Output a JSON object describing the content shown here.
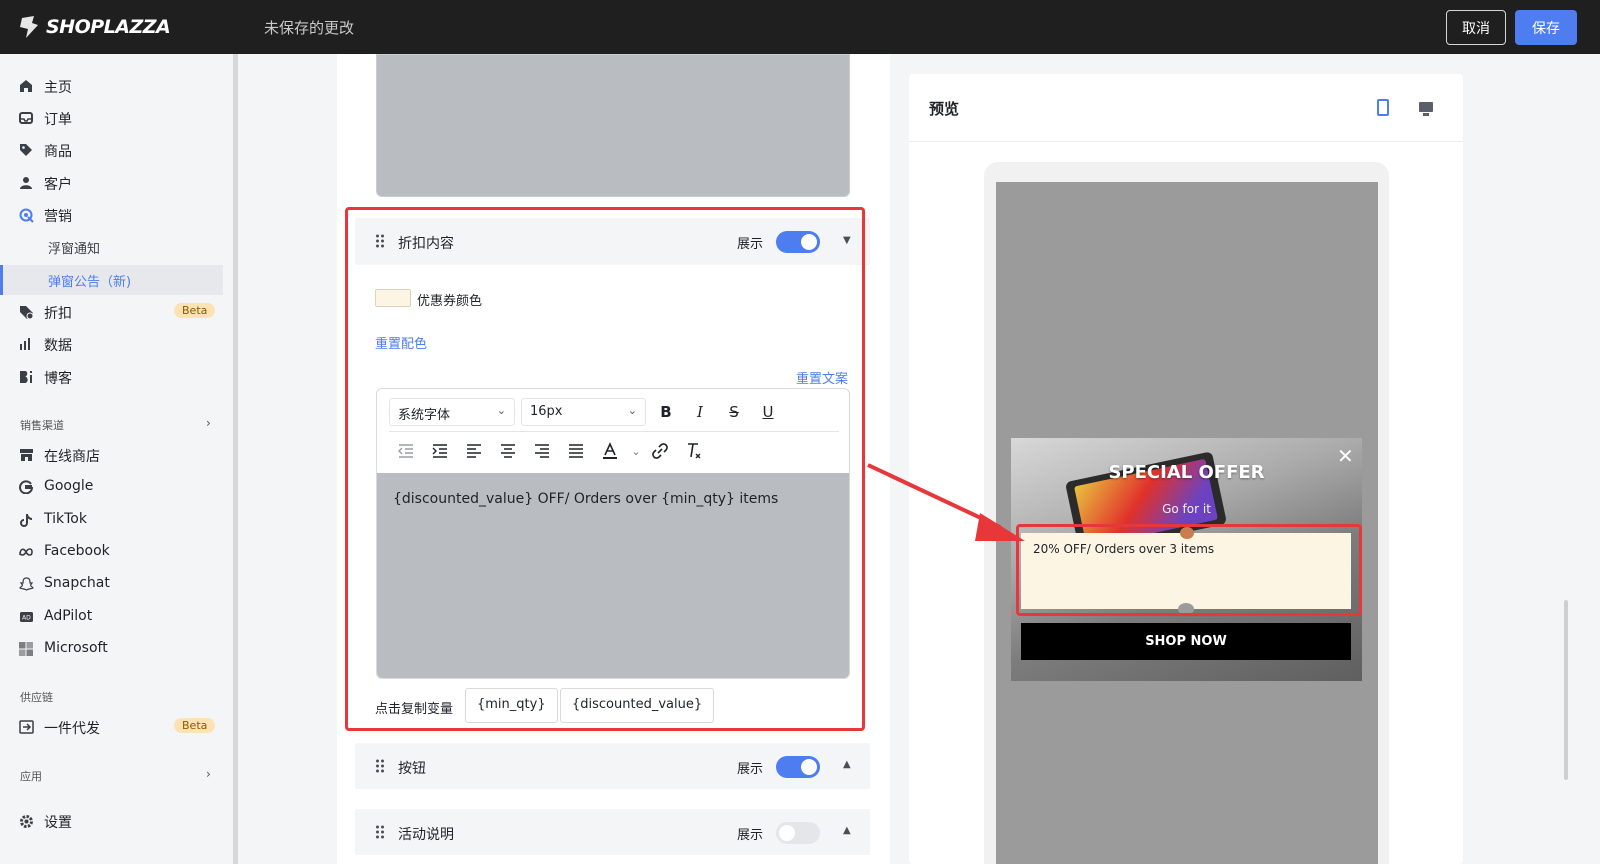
{
  "topbar": {
    "brand": "SHOPLAZZA",
    "unsaved": "未保存的更改",
    "cancel": "取消",
    "save": "保存"
  },
  "sidebar": {
    "items": [
      {
        "label": "主页",
        "icon": "home-icon"
      },
      {
        "label": "订单",
        "icon": "inbox-icon"
      },
      {
        "label": "商品",
        "icon": "tag-icon"
      },
      {
        "label": "客户",
        "icon": "person-icon"
      },
      {
        "label": "营销",
        "icon": "target-icon"
      },
      {
        "label": "浮窗通知"
      },
      {
        "label": "弹窗公告（新)"
      },
      {
        "label": "折扣",
        "icon": "discount-icon",
        "badge": "Beta"
      },
      {
        "label": "数据",
        "icon": "bar-chart-icon"
      },
      {
        "label": "博客",
        "icon": "blog-icon"
      }
    ],
    "sales_channels_title": "销售渠道",
    "channels": [
      {
        "label": "在线商店",
        "icon": "store-icon"
      },
      {
        "label": "Google",
        "icon": "google-icon"
      },
      {
        "label": "TikTok",
        "icon": "tiktok-icon"
      },
      {
        "label": "Facebook",
        "icon": "meta-icon"
      },
      {
        "label": "Snapchat",
        "icon": "snapchat-icon"
      },
      {
        "label": "AdPilot",
        "icon": "adpilot-icon"
      },
      {
        "label": "Microsoft",
        "icon": "microsoft-icon"
      }
    ],
    "supply_title": "供应链",
    "supply": [
      {
        "label": "一件代发",
        "icon": "dropship-icon",
        "badge": "Beta"
      }
    ],
    "apps_title": "应用",
    "settings": "设置"
  },
  "editor": {
    "discount_panel": {
      "title": "折扣内容",
      "show": "展示",
      "enabled": true,
      "coupon_color_label": "优惠券颜色",
      "coupon_color": "#fcf5e3",
      "reset_color": "重置配色",
      "reset_text": "重置文案",
      "font_select": "系统字体",
      "size_select": "16px",
      "content": "{discounted_value} OFF/ Orders over {min_qty} items",
      "copy_label": "点击复制变量",
      "variables": [
        "{min_qty}",
        "{discounted_value}"
      ]
    },
    "button_panel": {
      "title": "按钮",
      "show": "展示",
      "enabled": true
    },
    "activity_panel": {
      "title": "活动说明",
      "show": "展示",
      "enabled": false
    }
  },
  "preview": {
    "title": "预览",
    "popup_title": "SPECIAL OFFER",
    "popup_sub": "Go for it",
    "coupon_text": "20% OFF/ Orders over 3 items",
    "cta": "SHOP NOW"
  },
  "colors": {
    "accent": "#4d7df0",
    "highlight": "#e8373a"
  }
}
